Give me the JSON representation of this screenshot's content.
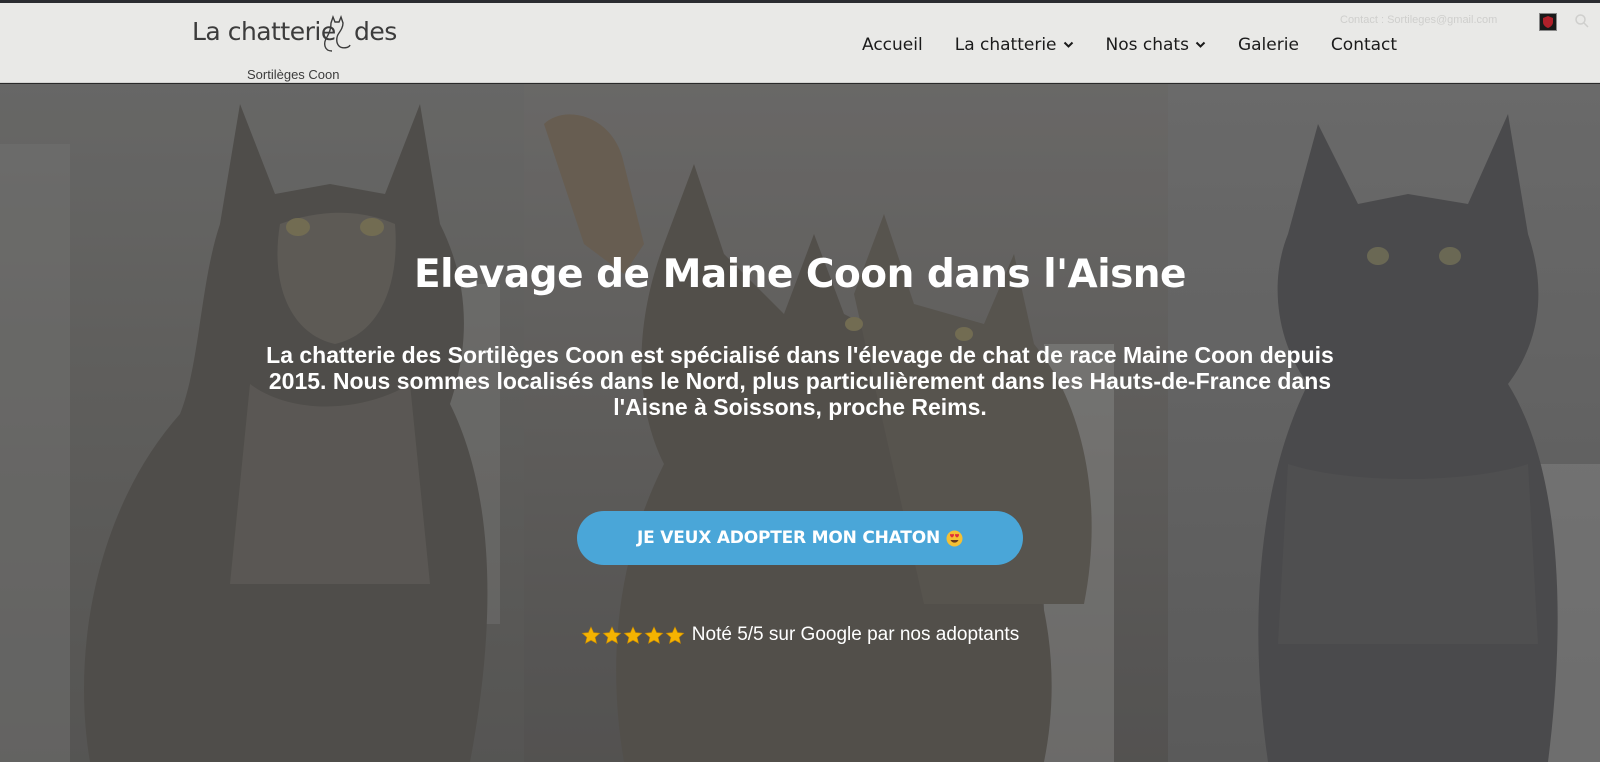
{
  "header": {
    "logo": {
      "line1_left": "La chatterie",
      "line1_right": "des",
      "line2": "Sortilèges Coon"
    },
    "nav": [
      {
        "label": "Accueil",
        "has_dropdown": false
      },
      {
        "label": "La chatterie",
        "has_dropdown": true
      },
      {
        "label": "Nos chats",
        "has_dropdown": true
      },
      {
        "label": "Galerie",
        "has_dropdown": false
      },
      {
        "label": "Contact",
        "has_dropdown": false
      }
    ],
    "top_right_text": "Contact : Sortileges@gmail.com"
  },
  "hero": {
    "title": "Elevage de Maine Coon dans l'Aisne",
    "subtitle": "La chatterie des Sortilèges Coon est spécialisé dans l'élevage de chat de race Maine Coon depuis 2015. Nous sommes localisés dans le Nord, plus particulièrement dans les Hauts-de-France dans l'Aisne à Soissons, proche Reims.",
    "cta_label": "JE VEUX ADOPTER MON CHATON",
    "rating_text": "Noté 5/5 sur Google par nos adoptants",
    "rating_stars": 5
  },
  "colors": {
    "header_bg": "#e9e9e7",
    "cta_bg": "#4aa6d8",
    "star": "#f5b301",
    "text_light": "#ffffff",
    "nav_text": "#1b1b1b"
  }
}
